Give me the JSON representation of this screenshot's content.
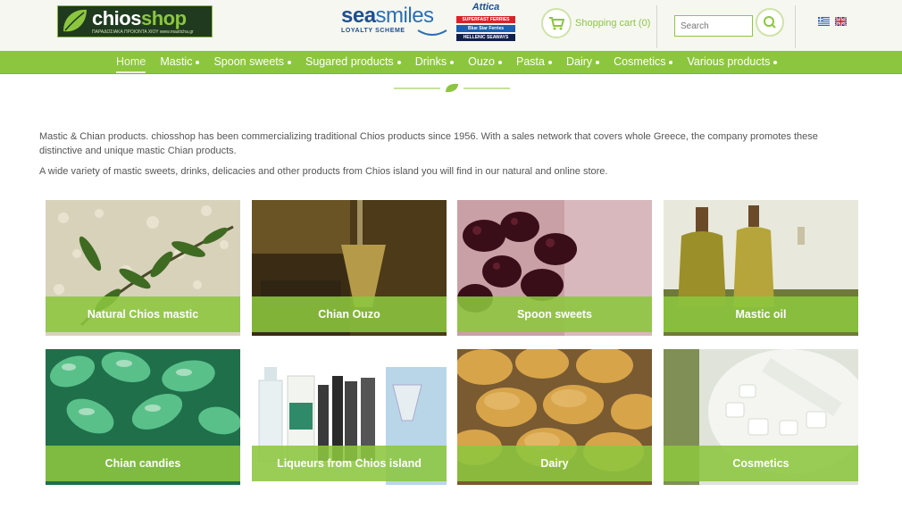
{
  "header": {
    "logo": {
      "brand_main": "chios",
      "brand_accent": "shop",
      "tagline": "ΠΑΡΑΔΟΣΙΑΚΑ ΠΡΟΙΟΝΤΑ ΧΙΟΥ www.masticha.gr"
    },
    "loyalty": {
      "brand_sea": "sea",
      "brand_smiles": "smiles",
      "subtitle": "LOYALTY SCHEME"
    },
    "partner": {
      "name": "Attica",
      "lines": [
        "SUPERFAST FERRIES",
        "Blue Star Ferries",
        "HELLENIC SEAWAYS"
      ]
    },
    "cart_label": "Shopping cart (0)",
    "search_placeholder": "Search"
  },
  "nav": {
    "items": [
      {
        "label": "Home",
        "active": true,
        "dot": false
      },
      {
        "label": "Mastic",
        "active": false,
        "dot": true
      },
      {
        "label": "Spoon sweets",
        "active": false,
        "dot": true
      },
      {
        "label": "Sugared products",
        "active": false,
        "dot": true
      },
      {
        "label": "Drinks",
        "active": false,
        "dot": true
      },
      {
        "label": "Ouzo",
        "active": false,
        "dot": true
      },
      {
        "label": "Pasta",
        "active": false,
        "dot": true
      },
      {
        "label": "Dairy",
        "active": false,
        "dot": true
      },
      {
        "label": "Cosmetics",
        "active": false,
        "dot": true
      },
      {
        "label": "Various products",
        "active": false,
        "dot": true
      }
    ]
  },
  "intro": {
    "paragraph1": "Mastic & Chian products. chiosshop has been commercializing traditional Chios products since 1956. With a sales network that covers whole Greece, the company promotes these distinctive and unique mastic Chian products.",
    "paragraph2": "A wide variety of mastic sweets, drinks, delicacies and other products from Chios island you will find in our natural and online store."
  },
  "categories": [
    {
      "label": "Natural Chios mastic"
    },
    {
      "label": "Chian Ouzo"
    },
    {
      "label": "Spoon sweets"
    },
    {
      "label": "Mastic oil"
    },
    {
      "label": "Chian candies"
    },
    {
      "label": "Liqueurs from Chios island"
    },
    {
      "label": "Dairy"
    },
    {
      "label": "Cosmetics"
    }
  ],
  "colors": {
    "accent": "#8cc63f",
    "nav_bg": "#8cc63f",
    "text": "#555555",
    "header_bg": "#f6f7f1"
  }
}
